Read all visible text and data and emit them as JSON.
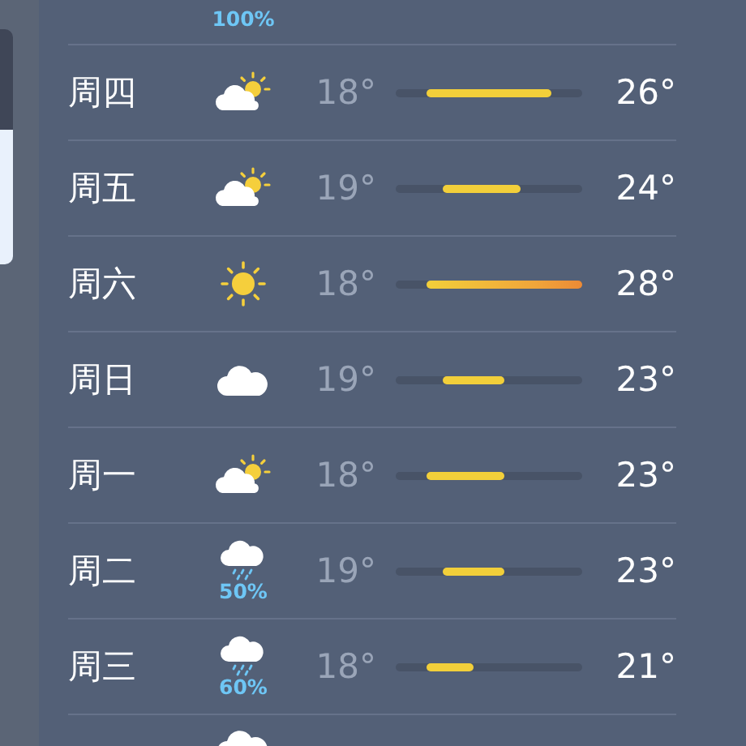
{
  "partial_top": {
    "precipitation": "100%"
  },
  "days": [
    {
      "day": "周四",
      "kind": "partly-cloudy",
      "low": "18°",
      "high": "26°"
    },
    {
      "day": "周五",
      "kind": "partly-cloudy",
      "low": "19°",
      "high": "24°"
    },
    {
      "day": "周六",
      "kind": "sunny",
      "low": "18°",
      "high": "28°"
    },
    {
      "day": "周日",
      "kind": "cloudy",
      "low": "19°",
      "high": "23°"
    },
    {
      "day": "周一",
      "kind": "partly-cloudy",
      "low": "18°",
      "high": "23°"
    },
    {
      "day": "周二",
      "kind": "rain",
      "precipitation": "50%",
      "low": "19°",
      "high": "23°"
    },
    {
      "day": "周三",
      "kind": "rain",
      "precipitation": "60%",
      "low": "18°",
      "high": "21°"
    }
  ],
  "partial_bottom": {
    "kind": "cloudy"
  }
}
